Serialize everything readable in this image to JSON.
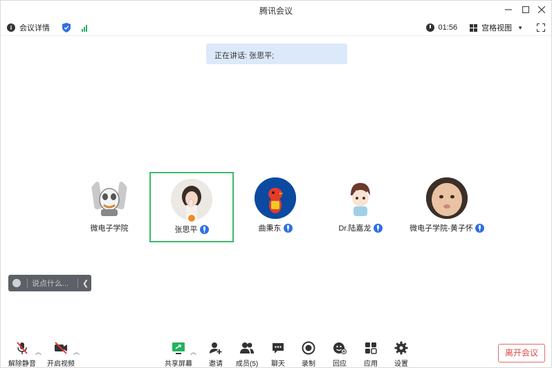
{
  "window": {
    "title": "腾讯会议"
  },
  "infobar": {
    "meeting_details": "会议详情",
    "timer": "01:56",
    "view_mode": "宫格视图"
  },
  "speaking_banner": "正在讲话: 张思平;",
  "participants": [
    {
      "name": "微电子学院",
      "mic": false,
      "active": false,
      "avatar": "cartoon-animals"
    },
    {
      "name": "张思平",
      "mic": true,
      "active": true,
      "host": true,
      "avatar": "girl-photo"
    },
    {
      "name": "曲秉东",
      "mic": true,
      "active": false,
      "avatar": "red-bird"
    },
    {
      "name": "Dr.陆嘉龙",
      "mic": true,
      "active": false,
      "avatar": "anime-kid"
    },
    {
      "name": "微电子学院-黄子怀",
      "mic": true,
      "active": false,
      "avatar": "baby-photo"
    }
  ],
  "chat": {
    "placeholder": "说点什么..."
  },
  "toolbar": {
    "unmute": "解除静音",
    "start_video": "开启视频",
    "share_screen": "共享屏幕",
    "invite": "邀请",
    "members": "成员(5)",
    "chat": "聊天",
    "record": "录制",
    "reactions": "回应",
    "apps": "应用",
    "settings": "设置",
    "leave": "离开会议"
  },
  "colors": {
    "active_border": "#3cba6a",
    "mic_blue": "#2e6fe6",
    "banner_bg": "#dce9fb",
    "leave_red": "#e04848",
    "share_green": "#22b35e"
  }
}
